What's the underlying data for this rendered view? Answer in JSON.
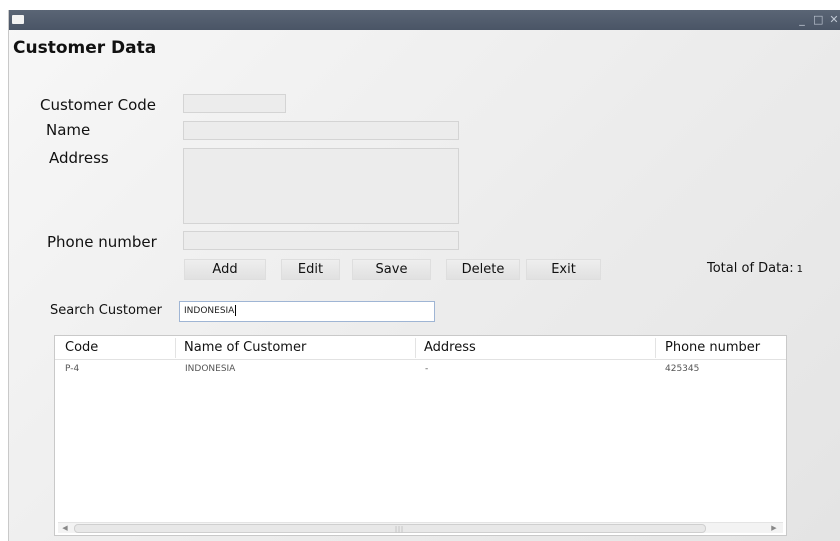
{
  "window": {
    "title_controls": [
      "_",
      "□",
      "✕"
    ]
  },
  "form": {
    "title": "Customer Data",
    "customer_code_label": "Customer Code",
    "name_label": "Name",
    "address_label": "Address",
    "phone_label": "Phone number"
  },
  "buttons": {
    "add": "Add",
    "edit": "Edit",
    "save": "Save",
    "delete": "Delete",
    "exit": "Exit"
  },
  "total": {
    "label": "Total of Data:",
    "value": "1"
  },
  "search": {
    "label": "Search Customer",
    "value": "INDONESIA"
  },
  "table": {
    "columns": [
      "Code",
      "Name of Customer",
      "Address",
      "Phone number"
    ],
    "rows": [
      [
        "P-4",
        "INDONESIA",
        "-",
        "425345"
      ]
    ]
  },
  "colors": {
    "titlebar": "#4e5969",
    "search_border": "#9fb5d4"
  }
}
